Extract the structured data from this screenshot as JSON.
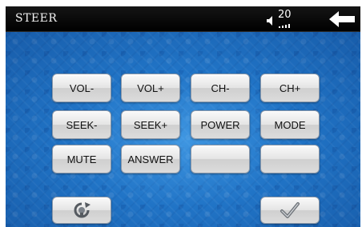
{
  "header": {
    "title": "STEER",
    "volume_level": "20",
    "icons": [
      "speaker-icon",
      "back-arrow-icon"
    ]
  },
  "keys": {
    "row1": [
      "VOL-",
      "VOL+",
      "CH-",
      "CH+"
    ],
    "row2": [
      "SEEK-",
      "SEEK+",
      "POWER",
      "MODE"
    ],
    "row3": [
      "MUTE",
      "ANSWER",
      "",
      ""
    ]
  },
  "footer": {
    "icons": [
      "learn-reset-icon",
      "checkmark-icon"
    ]
  },
  "colors": {
    "bar": "#000000",
    "background_blue": "#1f73c4",
    "button_face": "#e4e4e4"
  }
}
